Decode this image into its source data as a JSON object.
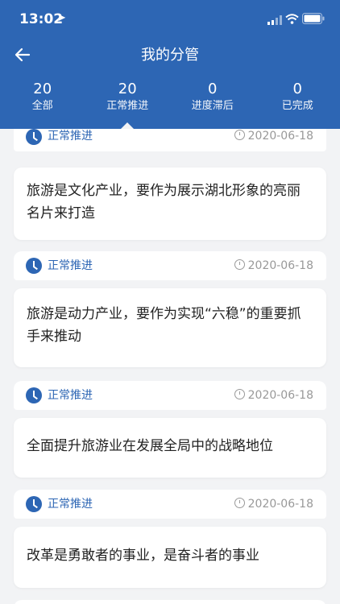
{
  "status_bar": {
    "time": "13:02"
  },
  "header": {
    "title": "我的分管"
  },
  "tabs": [
    {
      "count": "20",
      "label": "全部"
    },
    {
      "count": "20",
      "label": "正常推进"
    },
    {
      "count": "0",
      "label": "进度滞后"
    },
    {
      "count": "0",
      "label": "已完成"
    }
  ],
  "items": [
    {
      "status": "正常推进",
      "date": "2020-06-18",
      "text": "旅游是文化产业，要作为展示湖北形象的亮丽名片来打造"
    },
    {
      "status": "正常推进",
      "date": "2020-06-18",
      "text": "旅游是动力产业，要作为实现“六稳”的重要抓手来推动"
    },
    {
      "status": "正常推进",
      "date": "2020-06-18",
      "text": "全面提升旅游业在发展全局中的战略地位"
    },
    {
      "status": "正常推进",
      "date": "2020-06-18",
      "text": "改革是勇敢者的事业，是奋斗者的事业"
    }
  ],
  "colors": {
    "primary": "#2d66b4",
    "background": "#f2f3f5"
  }
}
